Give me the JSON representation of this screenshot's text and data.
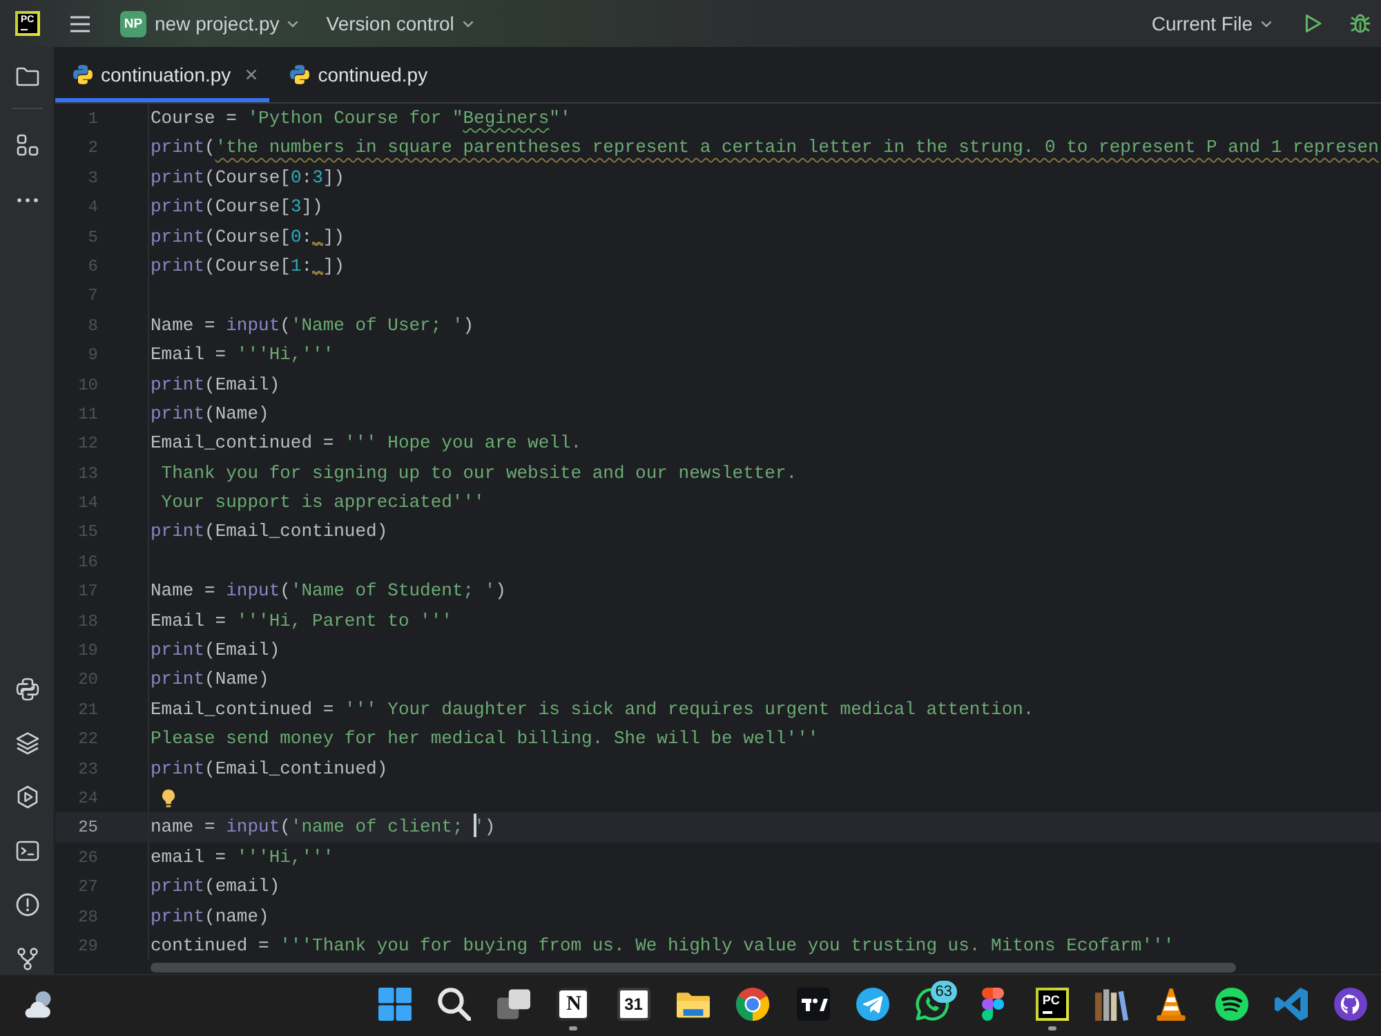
{
  "toolbar": {
    "logo": "PC",
    "project": {
      "badge": "NP",
      "name": "new project.py"
    },
    "vcs": "Version control",
    "run_config": "Current File"
  },
  "tabs": [
    {
      "label": "continuation.py",
      "selected": true
    },
    {
      "label": "continued.py",
      "selected": false
    }
  ],
  "editor": {
    "lines": [
      {
        "n": "1",
        "current": false,
        "code": [
          {
            "kind": "plain",
            "text": "Course = "
          },
          {
            "kind": "string",
            "text": "'Python Course for \""
          },
          {
            "kind": "typo",
            "text": "Beginers"
          },
          {
            "kind": "string",
            "text": "\"'"
          }
        ]
      },
      {
        "n": "2",
        "current": false,
        "code": [
          {
            "kind": "builtin",
            "text": "print"
          },
          {
            "kind": "plain",
            "text": "("
          },
          {
            "kind": "warning",
            "text": "'the numbers in square parentheses represent a certain letter in the strung. 0 to represent P and 1 represen"
          }
        ]
      },
      {
        "n": "3",
        "current": false,
        "code": [
          {
            "kind": "builtin",
            "text": "print"
          },
          {
            "kind": "plain",
            "text": "(Course["
          },
          {
            "kind": "number",
            "text": "0"
          },
          {
            "kind": "plain",
            "text": ":"
          },
          {
            "kind": "number",
            "text": "3"
          },
          {
            "kind": "plain",
            "text": "])"
          }
        ]
      },
      {
        "n": "4",
        "current": false,
        "code": [
          {
            "kind": "builtin",
            "text": "print"
          },
          {
            "kind": "plain",
            "text": "(Course["
          },
          {
            "kind": "number",
            "text": "3"
          },
          {
            "kind": "plain",
            "text": "])"
          }
        ]
      },
      {
        "n": "5",
        "current": false,
        "code": [
          {
            "kind": "builtin",
            "text": "print"
          },
          {
            "kind": "plain",
            "text": "(Course["
          },
          {
            "kind": "number",
            "text": "0"
          },
          {
            "kind": "lint",
            "text": ": "
          },
          {
            "kind": "plain",
            "text": "])"
          }
        ]
      },
      {
        "n": "6",
        "current": false,
        "code": [
          {
            "kind": "builtin",
            "text": "print"
          },
          {
            "kind": "plain",
            "text": "(Course["
          },
          {
            "kind": "number",
            "text": "1"
          },
          {
            "kind": "lint",
            "text": ": "
          },
          {
            "kind": "plain",
            "text": "])"
          }
        ]
      },
      {
        "n": "7",
        "current": false
      },
      {
        "n": "8",
        "current": false,
        "code": [
          {
            "kind": "plain",
            "text": "Name = "
          },
          {
            "kind": "builtin",
            "text": "input"
          },
          {
            "kind": "plain",
            "text": "("
          },
          {
            "kind": "string",
            "text": "'Name of User; '"
          },
          {
            "kind": "plain",
            "text": ")"
          }
        ]
      },
      {
        "n": "9",
        "current": false,
        "code": [
          {
            "kind": "plain",
            "text": "Email = "
          },
          {
            "kind": "string",
            "text": "'''Hi,'''"
          }
        ]
      },
      {
        "n": "10",
        "current": false,
        "code": [
          {
            "kind": "builtin",
            "text": "print"
          },
          {
            "kind": "plain",
            "text": "(Email)"
          }
        ]
      },
      {
        "n": "11",
        "current": false,
        "code": [
          {
            "kind": "builtin",
            "text": "print"
          },
          {
            "kind": "plain",
            "text": "(Name)"
          }
        ]
      },
      {
        "n": "12",
        "current": false,
        "code": [
          {
            "kind": "plain",
            "text": "Email_continued = "
          },
          {
            "kind": "string",
            "text": "''' Hope you are well."
          }
        ]
      },
      {
        "n": "13",
        "current": false,
        "code": [
          {
            "kind": "string",
            "text": " Thank you for signing up to our website and our newsletter."
          }
        ]
      },
      {
        "n": "14",
        "current": false,
        "code": [
          {
            "kind": "string",
            "text": " Your support is appreciated'''"
          }
        ]
      },
      {
        "n": "15",
        "current": false,
        "code": [
          {
            "kind": "builtin",
            "text": "print"
          },
          {
            "kind": "plain",
            "text": "(Email_continued)"
          }
        ]
      },
      {
        "n": "16",
        "current": false
      },
      {
        "n": "17",
        "current": false,
        "code": [
          {
            "kind": "plain",
            "text": "Name = "
          },
          {
            "kind": "builtin",
            "text": "input"
          },
          {
            "kind": "plain",
            "text": "("
          },
          {
            "kind": "string",
            "text": "'Name of Student; '"
          },
          {
            "kind": "plain",
            "text": ")"
          }
        ]
      },
      {
        "n": "18",
        "current": false,
        "code": [
          {
            "kind": "plain",
            "text": "Email = "
          },
          {
            "kind": "string",
            "text": "'''Hi, Parent to '''"
          }
        ]
      },
      {
        "n": "19",
        "current": false,
        "code": [
          {
            "kind": "builtin",
            "text": "print"
          },
          {
            "kind": "plain",
            "text": "(Email)"
          }
        ]
      },
      {
        "n": "20",
        "current": false,
        "code": [
          {
            "kind": "builtin",
            "text": "print"
          },
          {
            "kind": "plain",
            "text": "(Name)"
          }
        ]
      },
      {
        "n": "21",
        "current": false,
        "code": [
          {
            "kind": "plain",
            "text": "Email_continued = "
          },
          {
            "kind": "string",
            "text": "''' Your daughter is sick and requires urgent medical attention."
          }
        ]
      },
      {
        "n": "22",
        "current": false,
        "code": [
          {
            "kind": "string",
            "text": "Please send money for her medical billing. She will be well'''"
          }
        ]
      },
      {
        "n": "23",
        "current": false,
        "code": [
          {
            "kind": "builtin",
            "text": "print"
          },
          {
            "kind": "plain",
            "text": "(Email_continued)"
          }
        ]
      },
      {
        "n": "24",
        "current": false,
        "code": [
          {
            "kind": "bulb"
          }
        ]
      },
      {
        "n": "25",
        "current": true,
        "code": [
          {
            "kind": "plain",
            "text": "name = "
          },
          {
            "kind": "builtin",
            "text": "input"
          },
          {
            "kind": "plain",
            "text": "("
          },
          {
            "kind": "string",
            "text": "'name of client; "
          },
          {
            "kind": "caret"
          },
          {
            "kind": "string",
            "text": "'"
          },
          {
            "kind": "plain",
            "text": ")"
          }
        ]
      },
      {
        "n": "26",
        "current": false,
        "code": [
          {
            "kind": "plain",
            "text": "email = "
          },
          {
            "kind": "string",
            "text": "'''Hi,'''"
          }
        ]
      },
      {
        "n": "27",
        "current": false,
        "code": [
          {
            "kind": "builtin",
            "text": "print"
          },
          {
            "kind": "plain",
            "text": "(email)"
          }
        ]
      },
      {
        "n": "28",
        "current": false,
        "code": [
          {
            "kind": "builtin",
            "text": "print"
          },
          {
            "kind": "plain",
            "text": "(name)"
          }
        ]
      },
      {
        "n": "29",
        "current": false,
        "code": [
          {
            "kind": "plain",
            "text": "continued = "
          },
          {
            "kind": "string",
            "text": "'''Thank you for buying from us. We highly value you trusting us. Mitons Ecofarm'''"
          }
        ]
      }
    ]
  },
  "taskbar": {
    "apps": [
      {
        "running": true,
        "label": "N"
      },
      {
        "running": false,
        "label": "31"
      },
      {
        "running": false
      },
      {
        "running": false
      },
      {
        "running": false
      },
      {
        "running": false
      },
      {
        "running": false,
        "badge": "63"
      },
      {
        "running": false
      },
      {
        "running": true,
        "label": "PC"
      },
      {
        "running": false
      },
      {
        "running": false
      },
      {
        "running": false
      },
      {
        "running": false
      },
      {
        "running": false
      }
    ]
  }
}
